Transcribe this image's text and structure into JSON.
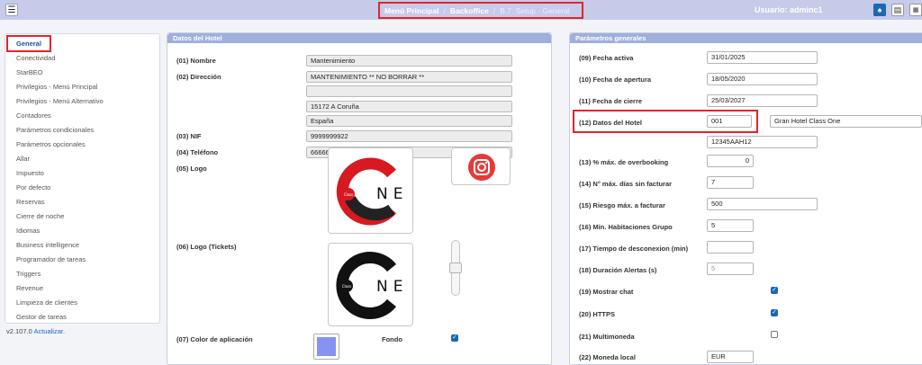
{
  "topbar": {
    "breadcrumb": {
      "main": "Menú Principal",
      "section": "Backoffice",
      "current": "B.7. Setup - General",
      "separator": "/"
    },
    "user": "Usuario: adminc1",
    "icons": [
      "menu-icon",
      "bell-icon",
      "document-icon",
      "grid-icon"
    ]
  },
  "sidebar": {
    "items": [
      "General",
      "Conectividad",
      "StarBEO",
      "Privilegios - Menú Principal",
      "Privilegios - Menú Alternativo",
      "Contadores",
      "Parámetros condicionales",
      "Parámetros opcionales",
      "Allar",
      "Impuesto",
      "Por defecto",
      "Reservas",
      "Cierre de noche",
      "Idiomas",
      "Business intelligence",
      "Programador de tareas",
      "Triggers",
      "Revenue",
      "Limpieza de clientes",
      "Gestor de tareas"
    ],
    "active_index": 0,
    "version": "v2.107.0",
    "update_link": "Actualizar."
  },
  "hotel": {
    "title": "Datos del Hotel",
    "nombre_label": "(01) Nombre",
    "nombre_value": "Mantenimiento",
    "direccion_label": "(02) Dirección",
    "direccion_lines": [
      "MANTENIMIENTO ** NO BORRAR **",
      "",
      "15172 A Coruña",
      "España"
    ],
    "nif_label": "(03) NIF",
    "nif_value": "9999999922",
    "telefono_label": "(04) Teléfono",
    "telefono_value": "666666777",
    "logo_label": "(05) Logo",
    "logo_text": "NE",
    "logo_small": "Class",
    "logo_tickets_label": "(06) Logo (Tickets)",
    "color_label": "(07) Color de aplicación",
    "color_value": "#8593f3",
    "fondo_label": "Fondo",
    "fondo_checked": true
  },
  "params": {
    "title": "Parámetros generales",
    "fecha_activa_label": "(09) Fecha activa",
    "fecha_activa": "31/01/2025",
    "fecha_apertura_label": "(10) Fecha de apertura",
    "fecha_apertura": "18/05/2020",
    "fecha_cierre_label": "(11) Fecha de cierre",
    "fecha_cierre": "25/03/2027",
    "datos_hotel_label": "(12) Datos del Hotel",
    "datos_hotel_code": "001",
    "datos_hotel_name": "Gran Hotel Class One",
    "datos_hotel_ref": "12345AAH12",
    "overbooking_label": "(13) % máx. de overbooking",
    "overbooking": "0",
    "dias_label": "(14) N° máx. días sin facturar",
    "dias": "7",
    "riesgo_label": "(15) Riesgo máx. a facturar",
    "riesgo": "500",
    "min_hab_label": "(16) Min. Habitaciones Grupo",
    "min_hab": "5",
    "desconexion_label": "(17) Tiempo de desconexion (min)",
    "desconexion": "",
    "alertas_label": "(18) Duración Alertas (s)",
    "alertas": "5",
    "chat_label": "(19) Mostrar chat",
    "chat": true,
    "https_label": "(20) HTTPS",
    "https": true,
    "multimoneda_label": "(21) Multimoneda",
    "multimoneda": false,
    "moneda_label": "(22) Moneda local",
    "moneda": "EUR"
  }
}
